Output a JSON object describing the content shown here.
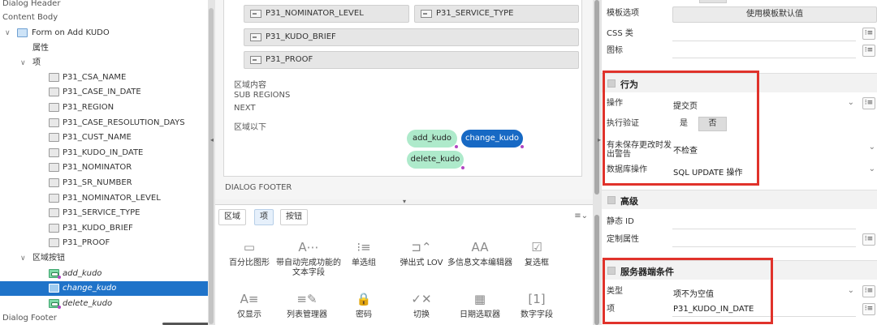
{
  "tree": {
    "rows": [
      {
        "label": "Dialog Header"
      },
      {
        "label": "Content Body"
      },
      {
        "label": "Form on Add KUDO",
        "twisty": "∨"
      },
      {
        "label": "属性"
      },
      {
        "label": "项",
        "twisty": "∨"
      },
      {
        "label": "P31_CSA_NAME"
      },
      {
        "label": "P31_CASE_IN_DATE"
      },
      {
        "label": "P31_REGION"
      },
      {
        "label": "P31_CASE_RESOLUTION_DAYS"
      },
      {
        "label": "P31_CUST_NAME"
      },
      {
        "label": "P31_KUDO_IN_DATE"
      },
      {
        "label": "P31_NOMINATOR"
      },
      {
        "label": "P31_SR_NUMBER"
      },
      {
        "label": "P31_NOMINATOR_LEVEL"
      },
      {
        "label": "P31_SERVICE_TYPE"
      },
      {
        "label": "P31_KUDO_BRIEF"
      },
      {
        "label": "P31_PROOF"
      },
      {
        "label": "区域按钮",
        "twisty": "∨"
      },
      {
        "label": "add_kudo"
      },
      {
        "label": "change_kudo"
      },
      {
        "label": "delete_kudo"
      },
      {
        "label": "Dialog Footer"
      }
    ]
  },
  "layout": {
    "fields": {
      "nominator_level": "P31_NOMINATOR_LEVEL",
      "service_type": "P31_SERVICE_TYPE",
      "kudo_brief": "P31_KUDO_BRIEF",
      "proof": "P31_PROOF"
    },
    "region_labels": [
      "区域内容",
      "SUB REGIONS",
      "NEXT",
      "区域以下"
    ],
    "buttons": {
      "add": "add_kudo",
      "change": "change_kudo",
      "delete": "delete_kudo"
    },
    "footer_label": "DIALOG FOOTER"
  },
  "gallery": {
    "tabs": [
      "区域",
      "项",
      "按钮"
    ],
    "active_tab": "项",
    "menu_icon": "list-menu-icon",
    "items": [
      {
        "label": "百分比图形",
        "icon": "percent-graph-icon",
        "glyph": "▭"
      },
      {
        "label": "带自动完成功能的文本字段",
        "icon": "autocomplete-icon",
        "glyph": "A⋯"
      },
      {
        "label": "单选组",
        "icon": "radio-group-icon",
        "glyph": "⁝≡"
      },
      {
        "label": "弹出式 LOV",
        "icon": "popup-lov-icon",
        "glyph": "⊐⌃"
      },
      {
        "label": "多信息文本编辑器",
        "icon": "rich-text-icon",
        "glyph": "AA"
      },
      {
        "label": "复选框",
        "icon": "checkbox-icon",
        "glyph": "☑"
      },
      {
        "label": "仅显示",
        "icon": "display-only-icon",
        "glyph": "A≡"
      },
      {
        "label": "列表管理器",
        "icon": "list-manager-icon",
        "glyph": "≡✎"
      },
      {
        "label": "密码",
        "icon": "password-icon",
        "glyph": "🔒"
      },
      {
        "label": "切换",
        "icon": "switch-icon",
        "glyph": "✓✕"
      },
      {
        "label": "日期选取器",
        "icon": "date-picker-icon",
        "glyph": "▦"
      },
      {
        "label": "数字字段",
        "icon": "number-field-icon",
        "glyph": "[1]"
      }
    ]
  },
  "props": {
    "template_options": {
      "label": "模板选项",
      "value": "使用模板默认值"
    },
    "css_class": {
      "label": "CSS 类",
      "value": ""
    },
    "icon": {
      "label": "图标",
      "value": ""
    },
    "behavior": {
      "title": "行为",
      "action": {
        "label": "操作",
        "value": "提交页"
      },
      "execute_validations": {
        "label": "执行验证",
        "yes": "是",
        "no": "否",
        "selected": "否"
      },
      "warn_unsaved": {
        "label": "有未保存更改时发出警告",
        "value": "不检查"
      },
      "db_action": {
        "label": "数据库操作",
        "value": "SQL UPDATE 操作"
      }
    },
    "advanced": {
      "title": "高级",
      "static_id": {
        "label": "静态 ID",
        "value": ""
      },
      "custom_attr": {
        "label": "定制属性",
        "value": ""
      }
    },
    "server_condition": {
      "title": "服务器端条件",
      "type": {
        "label": "类型",
        "value": "项不为空值"
      },
      "item": {
        "label": "项",
        "value": "P31_KUDO_IN_DATE"
      }
    }
  },
  "colors": {
    "selected": "#1f73c9",
    "highlight_box": "#e0322b",
    "button_green": "#aeeacb",
    "button_blue": "#1769c4"
  }
}
